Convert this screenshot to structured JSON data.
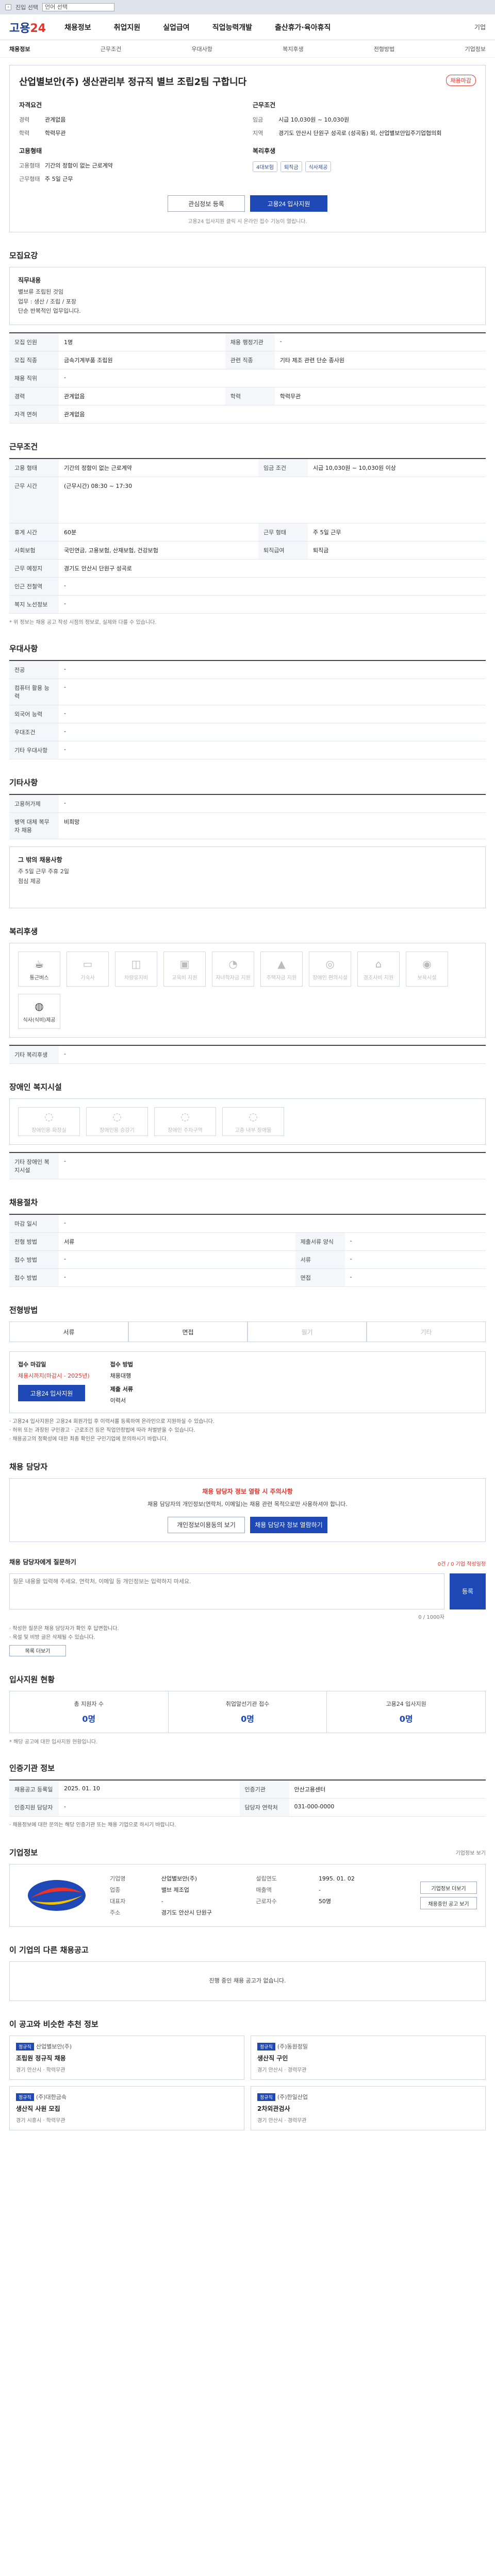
{
  "topbar": {
    "label": "진입 선택",
    "select": "언어 선택"
  },
  "gnb": {
    "logo_a": "고용",
    "logo_b": "24",
    "menu": [
      "채용정보",
      "취업지원",
      "실업급여",
      "직업능력개발",
      "출산휴가·육아휴직"
    ],
    "right": "기업"
  },
  "sub": {
    "items": [
      "채용정보",
      "근무조건",
      "우대사항",
      "복지후생",
      "전형방법",
      "기업정보"
    ]
  },
  "job": {
    "title": "산업별보안(주) 생산관리부 정규직 별브 조립2팀 구합니다",
    "badge": "채용마감",
    "left_title": "자격요건",
    "left": [
      {
        "k": "경력",
        "v": "관계없음"
      },
      {
        "k": "학력",
        "v": "학력무관"
      }
    ],
    "left2_title": "고용형태",
    "left2": [
      {
        "k": "고용형태",
        "v": "기간의 정함이 없는 근로계약"
      },
      {
        "k": "근무형태",
        "v": "주 5일 근무"
      }
    ],
    "right_title": "근무조건",
    "right": [
      {
        "k": "임금",
        "v": "시급 10,030원 ~ 10,030원"
      },
      {
        "k": "지역",
        "v": "경기도 안산시 단원구 성곡로 (성곡동) 외, 산업별보안입주기업협의회"
      }
    ],
    "chips_title": "복리후생",
    "chips": [
      "4대보험",
      "퇴직금",
      "식사제공"
    ],
    "save": "관심정보 등록",
    "apply": "고용24 입사지원",
    "note": "고용24 입사지원 클릭 시 온라인 접수 기능이 열립니다."
  },
  "recruit": {
    "title": "모집요강",
    "duty_label": "직무내용",
    "duty_lines": [
      "별브류 조립된 것임",
      "업무 : 생산 / 조립 / 포장",
      "단순 반복적인 업무입니다."
    ],
    "rows": [
      {
        "k": "모집 인원",
        "v": "1명",
        "k2": "채용 행정기관",
        "v2": "-"
      },
      {
        "k": "모집 직종",
        "v": "금속기계부품 조립원",
        "k2": "관련 직종",
        "v2": "기타 제조 관련 단순 종사원"
      },
      {
        "k": "채용 직위",
        "v": "-",
        "k2": "",
        "v2": ""
      },
      {
        "k": "경력",
        "v": "관계없음",
        "k2": "학력",
        "v2": "학력무관"
      },
      {
        "k": "자격 면허",
        "v": "관계없음",
        "k2": "",
        "v2": ""
      }
    ]
  },
  "cond": {
    "title": "근무조건",
    "rows": [
      {
        "k": "고용 형태",
        "v": "기간의 정함이 없는 근로계약",
        "k2": "임금 조건",
        "v2": "시급 10,030원 ~ 10,030원 이상"
      },
      {
        "k": "근무 시간",
        "v": "(근무시간)  08:30 ~ 17:30",
        "k2": "",
        "v2": ""
      },
      {
        "k": "휴게 시간",
        "v": "60분",
        "k2": "근무 형태",
        "v2": "주 5일 근무"
      },
      {
        "k": "사회보험",
        "v": "국민연금, 고용보험, 산재보험, 건강보험",
        "k2": "퇴직급여",
        "v2": "퇴직금"
      },
      {
        "k": "근무 예정지",
        "v": "경기도 안산시 단원구 성곡로",
        "k2": "",
        "v2": ""
      },
      {
        "k": "인근 전철역",
        "v": "-",
        "k2": "",
        "v2": ""
      },
      {
        "k": "복지 노선정보",
        "v": "-",
        "k2": "",
        "v2": ""
      }
    ],
    "note": "* 위 정보는 채용 공고 작성 시점의 정보로, 실제와 다를 수 있습니다."
  },
  "pref": {
    "title": "우대사항",
    "rows": [
      {
        "k": "전공",
        "v": "-"
      },
      {
        "k": "컴퓨터 활용 능력",
        "v": "-"
      },
      {
        "k": "외국어 능력",
        "v": "-"
      },
      {
        "k": "우대조건",
        "v": "-"
      },
      {
        "k": "기타 우대사항",
        "v": "-"
      }
    ]
  },
  "etc": {
    "title": "기타사항",
    "rows": [
      {
        "k": "고용허가제",
        "v": "-"
      },
      {
        "k": "병역 대체 복무자 채용",
        "v": "비희망"
      }
    ],
    "box_title": "그 밖의 채용사항",
    "box_lines": [
      "주 5일 근무 주휴 2일",
      "점심 제공"
    ]
  },
  "welfare": {
    "title": "복리후생",
    "items": [
      {
        "icon": "mug-icon",
        "label": "통근버스",
        "on": true
      },
      {
        "icon": "bed-icon",
        "label": "기숙사",
        "on": false
      },
      {
        "icon": "car-icon",
        "label": "차량유지비",
        "on": false
      },
      {
        "icon": "bag-icon",
        "label": "교육비 지원",
        "on": false
      },
      {
        "icon": "baby-icon",
        "label": "자녀학자금 지원",
        "on": false
      },
      {
        "icon": "cap-icon",
        "label": "주택자금 지원",
        "on": false
      },
      {
        "icon": "wheel-icon",
        "label": "장애인 편의시설",
        "on": false
      },
      {
        "icon": "house-icon",
        "label": "경조사비 지원",
        "on": false
      },
      {
        "icon": "child-icon",
        "label": "보육시설",
        "on": false
      },
      {
        "icon": "meal-icon",
        "label": "식사(식비)제공",
        "on": true
      }
    ],
    "other_label": "기타 복리후생",
    "other_value": "-"
  },
  "disabled": {
    "title": "장애인 복지시설",
    "items": [
      "장애인용 화장실",
      "장애인용 승강기",
      "장애인 주차구역",
      "고층 내부 장애물"
    ],
    "other_label": "기타 장애인 복지시설",
    "other_value": "-"
  },
  "select": {
    "title": "채용절차",
    "rows": [
      {
        "k": "마감 일시",
        "v": "-",
        "k2": "",
        "v2": ""
      },
      {
        "k": "전형 방법",
        "v": "서류",
        "k2": "제출서류 양식",
        "v2": "-"
      },
      {
        "k": "접수 방법",
        "v": "-",
        "k2": "서류",
        "v2": "-"
      },
      {
        "k": "접수 방법",
        "v": "-",
        "k2": "면접",
        "v2": "-"
      }
    ]
  },
  "method": {
    "title": "전형방법",
    "steps": [
      {
        "l": "서류",
        "on": true
      },
      {
        "l": "면접",
        "on": true
      },
      {
        "l": "필기",
        "on": false
      },
      {
        "l": "기타",
        "on": false
      }
    ]
  },
  "apply": {
    "cap1": "접수 마감일",
    "v1": "채용시까지(마감시 - 2025년)",
    "btn": "고용24 입사지원",
    "cap2": "접수 방법",
    "v2": "채용대행",
    "cap3": "제출 서류",
    "v3": "이력서",
    "bullets": [
      "· 고용24 입사지원은 고용24 회원가입 후 이력서를 등록하여 온라인으로 지원하실 수 있습니다.",
      "· 허위 또는 과장된 구인광고 · 근로조건 등은 직업안정법에 따라 처벌받을 수 있습니다.",
      "· 채용공고의 정확성에 대한 최종 확인은 구인기업에 문의하시기 바랍니다."
    ]
  },
  "hr": {
    "title": "채용 담당자",
    "msg1": "채용 담당자 정보 열람 시 주의사항",
    "msg2": "채용 담당자의 개인정보(연락처, 이메일)는 채용 관련 목적으로만 사용하셔야 합니다.",
    "btn1": "개인정보이용동의 보기",
    "btn2": "채용 담당자 정보 열람하기"
  },
  "ask": {
    "title": "채용 담당자에게 질문하기",
    "right": "0건 / 0 기업 작성일정",
    "placeholder": "질문 내용을 입력해 주세요. 연락처, 이메일 등 개인정보는 입력하지 마세요.",
    "count": "0 / 1000자",
    "send": "등록",
    "bullets": [
      "· 작성한 질문은 채용 담당자가 확인 후 답변합니다.",
      "· 욕설 및 비방 글은 삭제될 수 있습니다."
    ],
    "more": "목록 더보기"
  },
  "stats": {
    "title": "입사지원 현황",
    "items": [
      {
        "l": "총 지원자 수",
        "n": "0명"
      },
      {
        "l": "취업알선기관 접수",
        "n": "0명"
      },
      {
        "l": "고용24 입사지원",
        "n": "0명"
      }
    ],
    "note": "* 해당 공고에 대한 입사지원 현황입니다."
  },
  "agency": {
    "title": "인증기관 정보",
    "rows": [
      {
        "k": "채용공고 등록일",
        "v": "2025. 01. 10",
        "k2": "인증기관",
        "v2": "안산고용센터"
      },
      {
        "k": "인증지원 담당자",
        "v": "-",
        "k2": "담당자 연락처",
        "v2": "031-000-0000"
      }
    ],
    "note": "· 채용정보에 대한 문의는 해당 인증기관 또는 채용 기업으로 하시기 바랍니다."
  },
  "company": {
    "title": "기업정보",
    "logo_text": "S",
    "rows": [
      {
        "k": "기업명",
        "v": "산업별보안(주)",
        "k2": "설립연도",
        "v2": "1995. 01. 02"
      },
      {
        "k": "업종",
        "v": "밸브 제조업",
        "k2": "매출액",
        "v2": "-"
      },
      {
        "k": "대표자",
        "v": "-",
        "k2": "근로자수",
        "v2": "50명"
      },
      {
        "k": "주소",
        "v": "경기도 안산시 단원구",
        "k2": "",
        "v2": ""
      }
    ],
    "btn1": "기업정보 더보기",
    "btn2": "채용중인 공고 보기",
    "more": "기업정보 보기"
  },
  "other": {
    "title": "이 기업의 다른 채용공고",
    "empty": "진행 중인 채용 공고가 없습니다."
  },
  "recommend": {
    "title": "이 공고와 비슷한 추천 정보",
    "cards": [
      {
        "tag": "정규직",
        "name": "산업별보안(주)",
        "title": "조립원 정규직 채용",
        "meta": "경기 안산시 · 학력무관"
      },
      {
        "tag": "정규직",
        "name": "(주)동원정밀",
        "title": "생산직 구인",
        "meta": "경기 안산시 · 경력무관"
      },
      {
        "tag": "정규직",
        "name": "(주)대한금속",
        "title": "생산직 사원 모집",
        "meta": "경기 시흥시 · 학력무관"
      },
      {
        "tag": "정규직",
        "name": "(주)한일산업",
        "title": "2차외관검사",
        "meta": "경기 안산시 · 경력무관"
      }
    ]
  }
}
